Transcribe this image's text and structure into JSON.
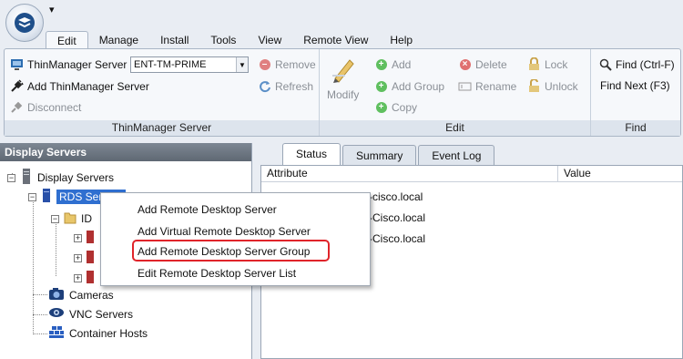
{
  "qat": {
    "glyph": "▾"
  },
  "tabs": [
    "Edit",
    "Manage",
    "Install",
    "Tools",
    "View",
    "Remote View",
    "Help"
  ],
  "ribbon": {
    "thinmanager_label": "ThinManager Server",
    "server_value": "ENT-TM-PRIME",
    "remove": "Remove",
    "refresh": "Refresh",
    "add_server": "Add ThinManager Server",
    "disconnect": "Disconnect",
    "group1": "ThinManager Server",
    "modify": "Modify",
    "add": "Add",
    "add_group": "Add Group",
    "copy": "Copy",
    "delete": "Delete",
    "rename": "Rename",
    "lock": "Lock",
    "unlock": "Unlock",
    "group2": "Edit",
    "find": "Find (Ctrl-F)",
    "find_next": "Find Next (F3)",
    "group3": "Find"
  },
  "left": {
    "header": "Display Servers",
    "tree": {
      "root": "Display Servers",
      "rds": "RDS Servers",
      "id_partial": "ID",
      "cameras": "Cameras",
      "vnc": "VNC Servers",
      "container": "Container Hosts"
    }
  },
  "right": {
    "tabs": [
      "Status",
      "Summary",
      "Event Log"
    ],
    "columns": [
      "Attribute",
      "Value"
    ],
    "rows": [
      "-cisco.local",
      "-Cisco.local",
      "-Cisco.local"
    ]
  },
  "menu": {
    "items": [
      "Add Remote Desktop Server",
      "Add Virtual Remote Desktop Server",
      "Add Remote Desktop Server Group",
      "Edit Remote Desktop Server List"
    ]
  }
}
